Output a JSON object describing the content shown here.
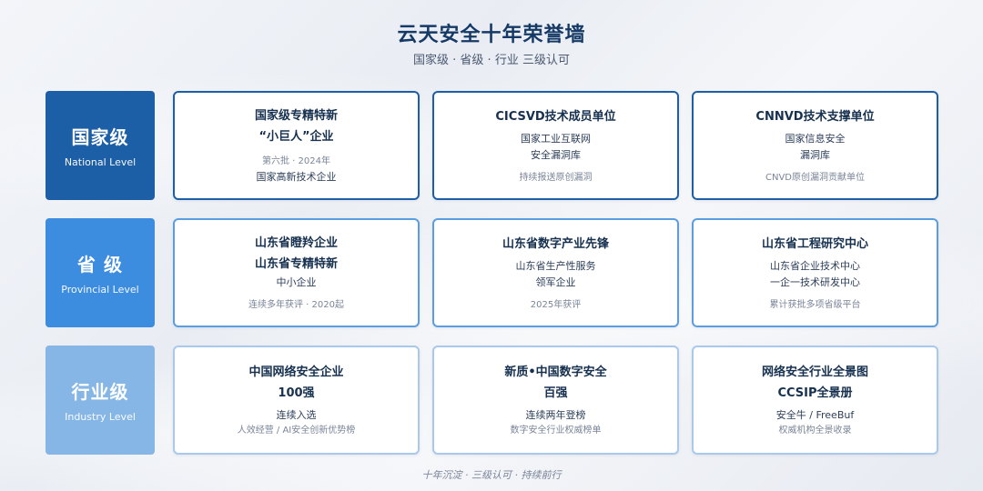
{
  "header": {
    "title": "云天安全十年荣誉墙",
    "subtitle": "国家级 · 省级 · 行业 三级认可"
  },
  "rows": [
    {
      "level_name": "国家级",
      "level_en": "National Level",
      "cards": [
        {
          "title_1": "国家级专精特新",
          "title_2": "“小巨人”企业",
          "note_1": "第六批 · 2024年",
          "line_1": "国家高新技术企业"
        },
        {
          "title_1": "CICSVD技术成员单位",
          "line_1": "国家工业互联网",
          "line_2": "安全漏洞库",
          "note_1": "持续报送原创漏洞"
        },
        {
          "title_1": "CNNVD技术支撑单位",
          "line_1": "国家信息安全",
          "line_2": "漏洞库",
          "note_1": "CNVD原创漏洞贡献单位"
        }
      ]
    },
    {
      "level_name": "省 级",
      "level_en": "Provincial Level",
      "cards": [
        {
          "title_1": "山东省瞪羚企业",
          "title_2": "山东省专精特新",
          "line_1": "中小企业",
          "note_1": "连续多年获评 · 2020起"
        },
        {
          "title_1": "山东省数字产业先锋",
          "line_1": "山东省生产性服务",
          "line_2": "领军企业",
          "note_1": "2025年获评"
        },
        {
          "title_1": "山东省工程研究中心",
          "line_1": "山东省企业技术中心",
          "line_2": "一企一技术研发中心",
          "note_1": "累计获批多项省级平台"
        }
      ]
    },
    {
      "level_name": "行业级",
      "level_en": "Industry Level",
      "cards": [
        {
          "title_1": "中国网络安全企业",
          "title_2": "100强",
          "line_1": "连续入选",
          "note_1": "人效经营 / AI安全创新优势榜"
        },
        {
          "title_1": "新质•中国数字安全",
          "title_2": "百强",
          "line_1": "连续两年登榜",
          "note_1": "数字安全行业权威榜单"
        },
        {
          "title_1": "网络安全行业全景图",
          "title_2": "CCSIP全景册",
          "line_1": "安全牛 / FreeBuf",
          "note_1": "权威机构全景收录"
        }
      ]
    }
  ],
  "footer": {
    "text": "十年沉淀 · 三级认可 · 持续前行"
  }
}
